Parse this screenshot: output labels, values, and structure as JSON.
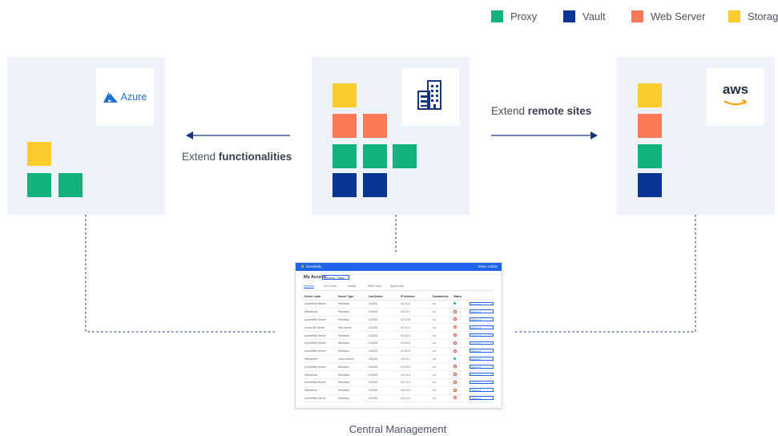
{
  "legend": [
    {
      "label": "Proxy",
      "color": "#12b27c"
    },
    {
      "label": "Vault",
      "color": "#0b3594"
    },
    {
      "label": "Web Server",
      "color": "#fb7a55"
    },
    {
      "label": "Storage",
      "color": "#fccb2e"
    }
  ],
  "colors": {
    "panel_bg": "#eef2fb",
    "arrow": "#16367a",
    "connector": "#3c5aa6",
    "azure_blue": "#1f6fd1",
    "aws_text": "#232f3e",
    "aws_orange": "#ff9900"
  },
  "sites": {
    "left": {
      "logo_text": "Azure",
      "logo_icon": "azure-icon",
      "tiles": [
        "storage",
        "proxy",
        "proxy"
      ]
    },
    "center": {
      "logo_icon": "building-icon",
      "tiles": [
        "storage",
        "web",
        "web",
        "proxy",
        "proxy",
        "proxy",
        "vault",
        "vault"
      ]
    },
    "right": {
      "logo_text": "aws",
      "logo_icon": "aws-icon",
      "tiles": [
        "storage",
        "web",
        "proxy",
        "vault"
      ]
    }
  },
  "arrows": {
    "left_label_prefix": "Extend ",
    "left_label_bold": "functionalities",
    "right_label_prefix": "Extend ",
    "right_label_bold": "remote sites"
  },
  "central": {
    "caption": "Central Management",
    "app": {
      "brand": "⚡ sensitivity",
      "user": "Team Admin",
      "title": "My Access",
      "select_value": "Servers / Team",
      "tabs": [
        "Servers",
        "Db Creds",
        "Vaults",
        "Wiki Links",
        "Approvals"
      ],
      "columns": [
        "Server Label",
        "Server Type",
        "Last Active",
        "IP Address",
        "Domain/Acc",
        "Status",
        ""
      ],
      "rows": [
        {
          "name": "AzureWeb Server",
          "type": "Windows",
          "last": "3/24/20",
          "ip": "10.0.0.2",
          "acc": "no",
          "status": "ok",
          "action": "Actions ▾"
        },
        {
          "name": "Webserver",
          "type": "Windows",
          "last": "3/24/20",
          "ip": "10.0.0.7",
          "acc": "no",
          "status": "err",
          "action": "Actions ▾"
        },
        {
          "name": "AzureWeb Server",
          "type": "Windows",
          "last": "3/24/20",
          "ip": "10.0.0.8",
          "acc": "no",
          "status": "err",
          "action": "Actions ▾"
        },
        {
          "name": "Azure DB Server",
          "type": "Win Server",
          "last": "3/24/20",
          "ip": "10.0.0.4",
          "acc": "no",
          "status": "err",
          "action": "Actions ▾"
        },
        {
          "name": "AzureWeb Server",
          "type": "Windows",
          "last": "3/24/20",
          "ip": "10.0.0.5",
          "acc": "no",
          "status": "err",
          "action": "Actions ▾"
        },
        {
          "name": "AzureWeb Server",
          "type": "Windows",
          "last": "3/24/20",
          "ip": "10.0.0.6",
          "acc": "no",
          "status": "err",
          "action": "Actions ▾"
        },
        {
          "name": "AzureWeb Server",
          "type": "Windows",
          "last": "3/24/20",
          "ip": "10.0.0.9",
          "acc": "no",
          "status": "err",
          "action": "Actions ▾"
        },
        {
          "name": "Webserver",
          "type": "Linux Ubuntu",
          "last": "3/24/20",
          "ip": "10.0.1.1",
          "acc": "no",
          "status": "ok",
          "action": "Actions ▾"
        },
        {
          "name": "AzureWeb Server",
          "type": "Windows",
          "last": "3/24/20",
          "ip": "10.0.1.2",
          "acc": "no",
          "status": "err",
          "action": "Actions ▾"
        },
        {
          "name": "Webserver",
          "type": "Windows",
          "last": "3/24/20",
          "ip": "10.0.1.3",
          "acc": "no",
          "status": "err",
          "action": "Actions ▾"
        },
        {
          "name": "AzureWeb Server",
          "type": "Windows",
          "last": "3/24/20",
          "ip": "10.0.1.4",
          "acc": "no",
          "status": "err",
          "action": "Actions ▾"
        },
        {
          "name": "Webserver",
          "type": "Windows",
          "last": "3/24/20",
          "ip": "10.0.1.5",
          "acc": "no",
          "status": "err",
          "action": "Actions ▾"
        },
        {
          "name": "AzureWeb Server",
          "type": "Windows",
          "last": "3/24/20",
          "ip": "10.0.1.6",
          "acc": "no",
          "status": "err",
          "action": "Actions ▾"
        }
      ]
    }
  }
}
